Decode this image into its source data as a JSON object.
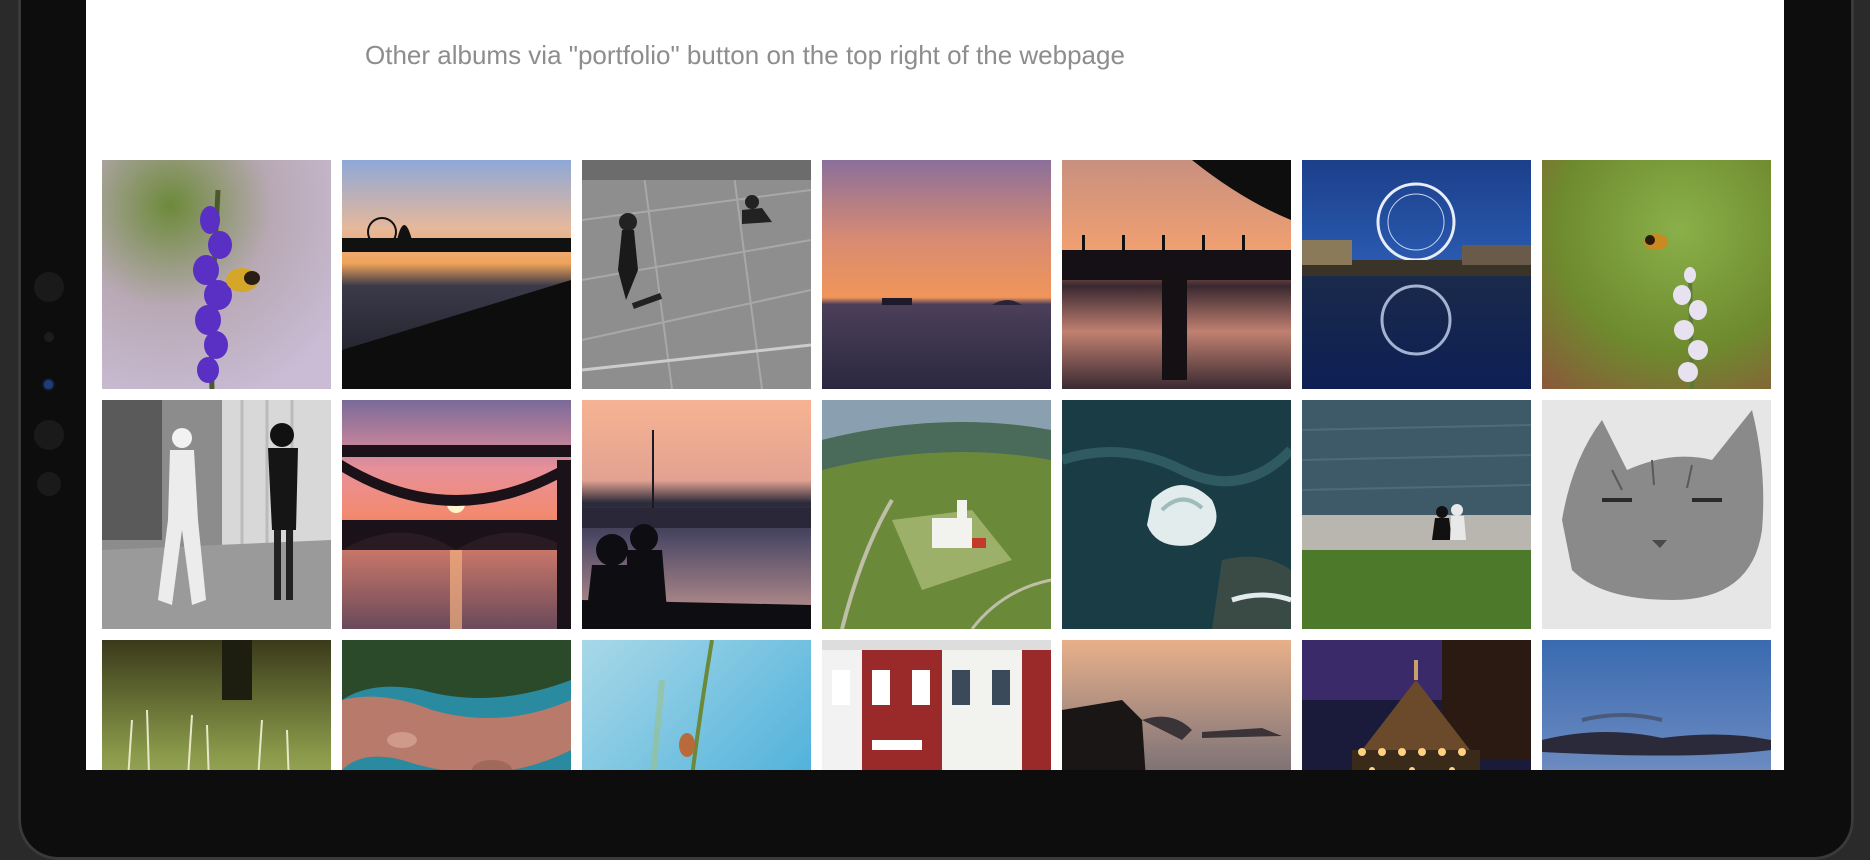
{
  "page": {
    "subtitle": "Other albums via \"portfolio\" button on the top right of the webpage"
  },
  "gallery": {
    "photos": [
      {
        "icon": "lavender-bee-photo"
      },
      {
        "icon": "river-sunset-silhouette-photo"
      },
      {
        "icon": "skateboarder-bw-photo"
      },
      {
        "icon": "sea-sunset-boat-photo"
      },
      {
        "icon": "bridge-sunset-photo"
      },
      {
        "icon": "ferris-wheel-night-photo"
      },
      {
        "icon": "bee-flower-photo"
      },
      {
        "icon": "street-sailor-photo"
      },
      {
        "icon": "bridge-sunset-sun-photo"
      },
      {
        "icon": "harbor-couple-sunset-photo"
      },
      {
        "icon": "lighthouse-aerial-photo"
      },
      {
        "icon": "ocean-waves-aerial-photo"
      },
      {
        "icon": "riverbank-people-photo"
      },
      {
        "icon": "cat-bw-photo"
      },
      {
        "icon": "grass-closeup-photo"
      },
      {
        "icon": "rocky-shore-aerial-photo"
      },
      {
        "icon": "plant-blue-sky-photo"
      },
      {
        "icon": "storefront-buildings-photo"
      },
      {
        "icon": "coast-cliffs-sunset-photo"
      },
      {
        "icon": "carousel-night-photo"
      },
      {
        "icon": "clouds-dusk-photo"
      }
    ]
  }
}
